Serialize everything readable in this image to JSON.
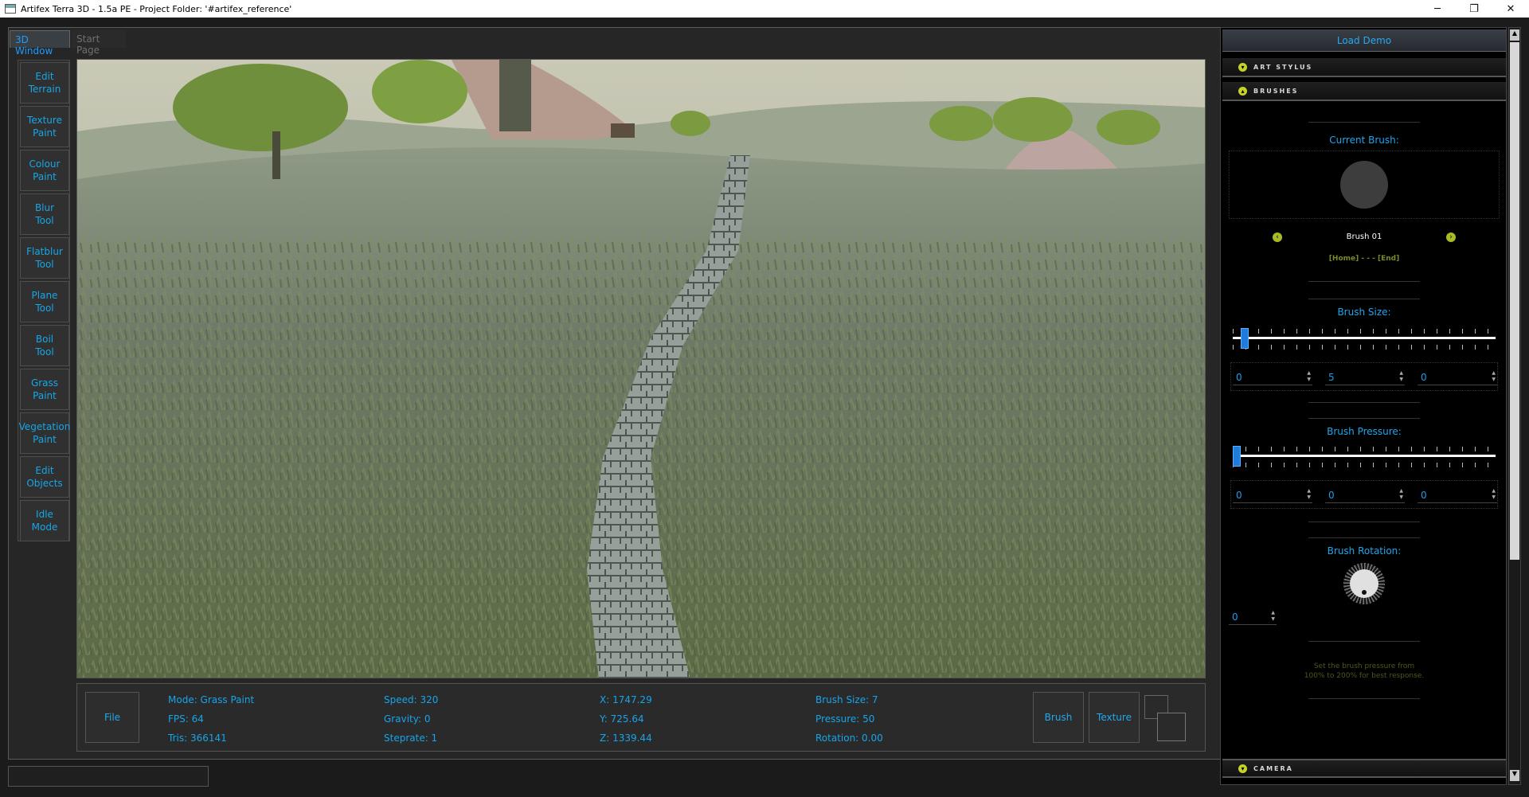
{
  "window": {
    "title": "Artifex Terra 3D - 1.5a PE - Project Folder: '#artifex_reference'",
    "minimize": "─",
    "restore": "❐",
    "close": "✕"
  },
  "tabs": [
    {
      "label": "3D Window"
    },
    {
      "label": "Start Page"
    }
  ],
  "tools": [
    {
      "label": "Edit\nTerrain"
    },
    {
      "label": "Texture\nPaint"
    },
    {
      "label": "Colour\nPaint"
    },
    {
      "label": "Blur\nTool"
    },
    {
      "label": "Flatblur\nTool"
    },
    {
      "label": "Plane\nTool"
    },
    {
      "label": "Boil\nTool"
    },
    {
      "label": "Grass\nPaint"
    },
    {
      "label": "Vegetation\nPaint"
    },
    {
      "label": "Edit\nObjects"
    },
    {
      "label": "Idle\nMode"
    }
  ],
  "status": {
    "file_button": "File",
    "mode": "Mode: Grass Paint",
    "fps": "FPS: 64",
    "tris": "Tris: 366141",
    "speed": "Speed: 320",
    "gravity": "Gravity: 0",
    "steprate": "Steprate: 1",
    "x": "X: 1747.29",
    "y": "Y: 725.64",
    "z": "Z: 1339.44",
    "brush_size": "Brush Size: 7",
    "pressure": "Pressure: 50",
    "rotation": "Rotation: 0.00",
    "brush_button": "Brush",
    "texture_button": "Texture"
  },
  "panel": {
    "load_demo": "Load Demo",
    "sections": {
      "art_stylus": "ART STYLUS",
      "brushes": "BRUSHES",
      "camera": "CAMERA"
    },
    "current_brush_label": "Current Brush:",
    "brush_name": "Brush 01",
    "home_end": "[Home] - - - [End]",
    "brush_size_label": "Brush Size:",
    "brush_size_level": 0.03,
    "brush_size_values": [
      "0",
      "5",
      "0"
    ],
    "brush_pressure_label": "Brush Pressure:",
    "brush_pressure_level": 0.0,
    "brush_pressure_values": [
      "0",
      "0",
      "0"
    ],
    "brush_rotation_label": "Brush Rotation:",
    "brush_rotation_value": "0",
    "hint": "Set the brush pressure from\n100% to 200% for best response."
  },
  "colors": {
    "accent": "#1fa6ee",
    "handle": "#1f7cd8",
    "section_chevron": "#c5d22a",
    "hint_text": "#4a5a1c"
  }
}
